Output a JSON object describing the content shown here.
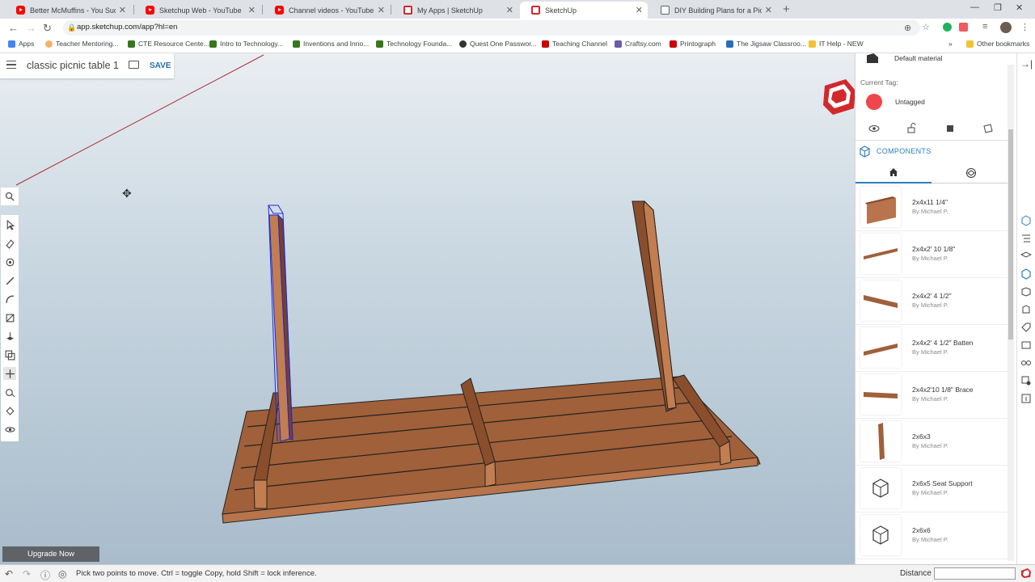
{
  "browser": {
    "tabs": [
      {
        "label": "Better McMuffins - You Suck at C",
        "icon": "youtube-icon"
      },
      {
        "label": "Sketchup Web - YouTube",
        "icon": "youtube-icon"
      },
      {
        "label": "Channel videos - YouTube Studio",
        "icon": "youtube-icon"
      },
      {
        "label": "My Apps | SketchUp",
        "icon": "sketchup-icon"
      },
      {
        "label": "SketchUp",
        "icon": "sketchup-icon"
      },
      {
        "label": "DIY Building Plans for a Picnic Ta",
        "icon": "document-icon"
      }
    ],
    "url": "app.sketchup.com/app?hl=en",
    "bookmarks": [
      {
        "label": "Apps"
      },
      {
        "label": "Teacher Mentoring..."
      },
      {
        "label": "CTE Resource Cente..."
      },
      {
        "label": "Intro to Technology..."
      },
      {
        "label": "Inventions and Inno..."
      },
      {
        "label": "Technology Founda..."
      },
      {
        "label": "Quest One Passwor..."
      },
      {
        "label": "Teaching Channel"
      },
      {
        "label": "Craftsy.com"
      },
      {
        "label": "Printograph"
      },
      {
        "label": "The Jigsaw Classroo..."
      },
      {
        "label": "IT Help - NEW"
      }
    ],
    "other_bookmarks": "Other bookmarks",
    "more_bookmarks": "»"
  },
  "app": {
    "model_name": "classic picnic table 1",
    "save_label": "SAVE",
    "upgrade_label": "Upgrade Now",
    "status_text": "Pick two points to move. Ctrl = toggle Copy, hold Shift = lock inference.",
    "distance_label": "Distance",
    "distance_value": ""
  },
  "panel": {
    "material_name": "Default material",
    "current_tag_label": "Current Tag:",
    "current_tag_name": "Untagged",
    "tag_color": "#f0454c",
    "components_title": "COMPONENTS",
    "components": [
      {
        "name": "2x4x11 1/4\"",
        "author": "By Michael P."
      },
      {
        "name": "2x4x2' 10 1/8\"",
        "author": "By Michael P."
      },
      {
        "name": "2x4x2' 4 1/2\"",
        "author": "By Michael P."
      },
      {
        "name": "2x4x2' 4 1/2\" Batten",
        "author": "By Michael P."
      },
      {
        "name": "2x4x2'10 1/8\" Brace",
        "author": "By Michael P."
      },
      {
        "name": "2x6x3",
        "author": "By Michael P."
      },
      {
        "name": "2x6x5 Seat Support",
        "author": "By Michael P."
      },
      {
        "name": "2x6x6",
        "author": "By Michael P."
      }
    ]
  },
  "colors": {
    "accent": "#2c7fbd",
    "wood": "#a0603a",
    "selection": "#1e2bd6",
    "sketchup_red": "#d1282e"
  }
}
